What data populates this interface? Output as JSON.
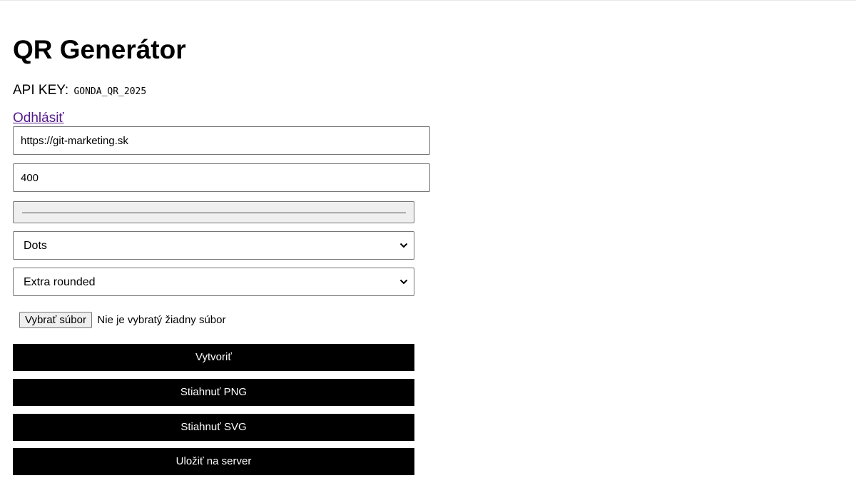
{
  "header": {
    "title": "QR Generátor"
  },
  "api_key": {
    "label": "API KEY:",
    "value": "GONDA_QR_2025"
  },
  "logout": {
    "label": "Odhlásiť"
  },
  "form": {
    "url_value": "https://git-marketing.sk",
    "size_value": "400",
    "pattern_select": {
      "selected": "Dots"
    },
    "corner_select": {
      "selected": "Extra rounded"
    },
    "file": {
      "button_label": "Vybrať súbor",
      "status": "Nie je vybratý žiadny súbor"
    }
  },
  "actions": {
    "create": "Vytvoriť",
    "download_png": "Stiahnuť PNG",
    "download_svg": "Stiahnuť SVG",
    "save_server": "Uložiť na server"
  },
  "colors": {
    "button_bg": "#000000",
    "button_text": "#ffffff",
    "link": "#551a8b"
  },
  "icons": {
    "select_arrow": "chevron-down-icon"
  }
}
